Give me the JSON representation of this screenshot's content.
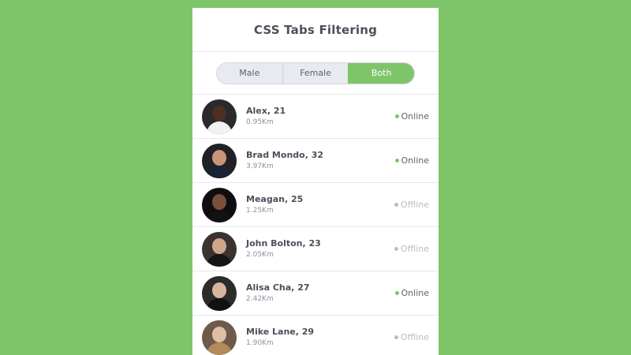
{
  "title": "CSS Tabs Filtering",
  "tabs": [
    {
      "label": "Male",
      "active": false
    },
    {
      "label": "Female",
      "active": false
    },
    {
      "label": "Both",
      "active": true
    }
  ],
  "colors": {
    "accent": "#7ec56a",
    "online": "#7ec56a",
    "offline": "#b9bdc4"
  },
  "users": [
    {
      "name": "Alex, 21",
      "distance": "0.95Km",
      "status": "Online",
      "online": true,
      "avatar": {
        "bg": "#2a2a2c",
        "skin": "#4a2f22",
        "cloth": "#f2f2f2"
      }
    },
    {
      "name": "Brad Mondo, 32",
      "distance": "3.97Km",
      "status": "Online",
      "online": true,
      "avatar": {
        "bg": "#1f2126",
        "skin": "#c8957a",
        "cloth": "#1b2233"
      }
    },
    {
      "name": "Meagan, 25",
      "distance": "1.25Km",
      "status": "Offline",
      "online": false,
      "avatar": {
        "bg": "#0e0e10",
        "skin": "#7a4f3a",
        "cloth": "#121212"
      }
    },
    {
      "name": "John Bolton, 23",
      "distance": "2.05Km",
      "status": "Offline",
      "online": false,
      "avatar": {
        "bg": "#3a3330",
        "skin": "#d3a48c",
        "cloth": "#151515"
      }
    },
    {
      "name": "Alisa Cha, 27",
      "distance": "2.42Km",
      "status": "Online",
      "online": true,
      "avatar": {
        "bg": "#2b2b2b",
        "skin": "#d9b49e",
        "cloth": "#111111"
      }
    },
    {
      "name": "Mike Lane, 29",
      "distance": "1.90Km",
      "status": "Offline",
      "online": false,
      "avatar": {
        "bg": "#6d5a4a",
        "skin": "#e2bfa4",
        "cloth": "#b38a5a"
      }
    }
  ]
}
